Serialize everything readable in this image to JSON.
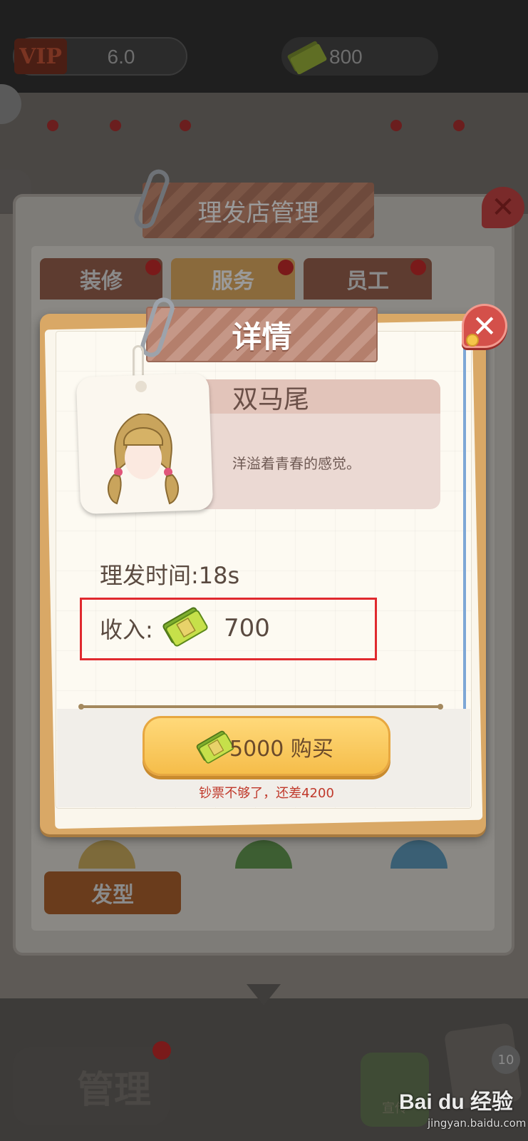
{
  "topbar": {
    "vip_badge": "VIP",
    "vip_value": "6.0",
    "money_value": "800"
  },
  "management_window": {
    "title": "理发店管理",
    "tabs": [
      {
        "label": "装修"
      },
      {
        "label": "服务"
      },
      {
        "label": "员工"
      }
    ],
    "category_label": "发型"
  },
  "detail_dialog": {
    "title": "详情",
    "close_glyph": "✕",
    "item_name": "双马尾",
    "item_description": "洋溢着青春的感觉。",
    "haircut_time": "理发时间:18s",
    "income_label": "收入:",
    "income_value": "700",
    "buy_button_label": "5000 购买",
    "shortage_note": "钞票不够了，还差4200"
  },
  "bottom_bar": {
    "manage_label": "管理",
    "share_label": "宣传",
    "notes_count": "10"
  },
  "watermark": {
    "brand": "Bai du 经验",
    "url": "jingyan.baidu.com"
  },
  "icons": {
    "money": "banknote-stack-icon",
    "close": "close-icon",
    "clip": "paperclip-icon"
  },
  "colors": {
    "dialog_frame": "#d9a866",
    "buy_button": "#f5bd4a",
    "highlight_box": "#e0292e",
    "note_text": "#c0392b"
  }
}
